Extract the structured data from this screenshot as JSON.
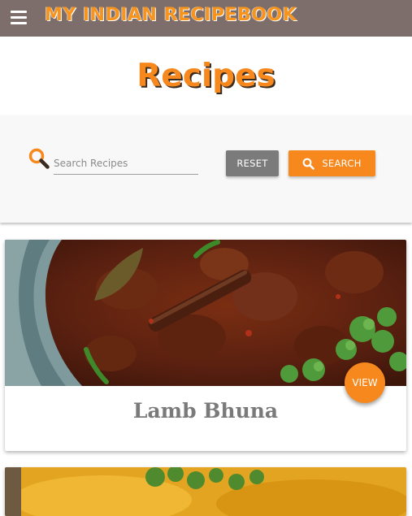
{
  "navbar": {
    "menu_icon": "hamburger-menu-icon",
    "brand": "MY INDIAN RECIPEBOOK",
    "background_color": "#7d6e6c",
    "brand_color": "#f7941d"
  },
  "page": {
    "title": "Recipes",
    "title_color": "#f7881d"
  },
  "search": {
    "icon": "search-icon",
    "placeholder": "Search Recipes",
    "value": "",
    "reset_label": "RESET",
    "search_label": "SEARCH",
    "search_button_icon": "search-icon"
  },
  "recipes": [
    {
      "name": "Lamb Bhuna",
      "action_label": "VIEW",
      "image": "lamb-bhuna-curry-photo"
    },
    {
      "name": "",
      "action_label": "",
      "image": "yellow-curry-photo"
    }
  ],
  "colors": {
    "accent": "#f7881d",
    "reset_button": "#7b7b7b",
    "panel_background": "#f8f8f8"
  }
}
